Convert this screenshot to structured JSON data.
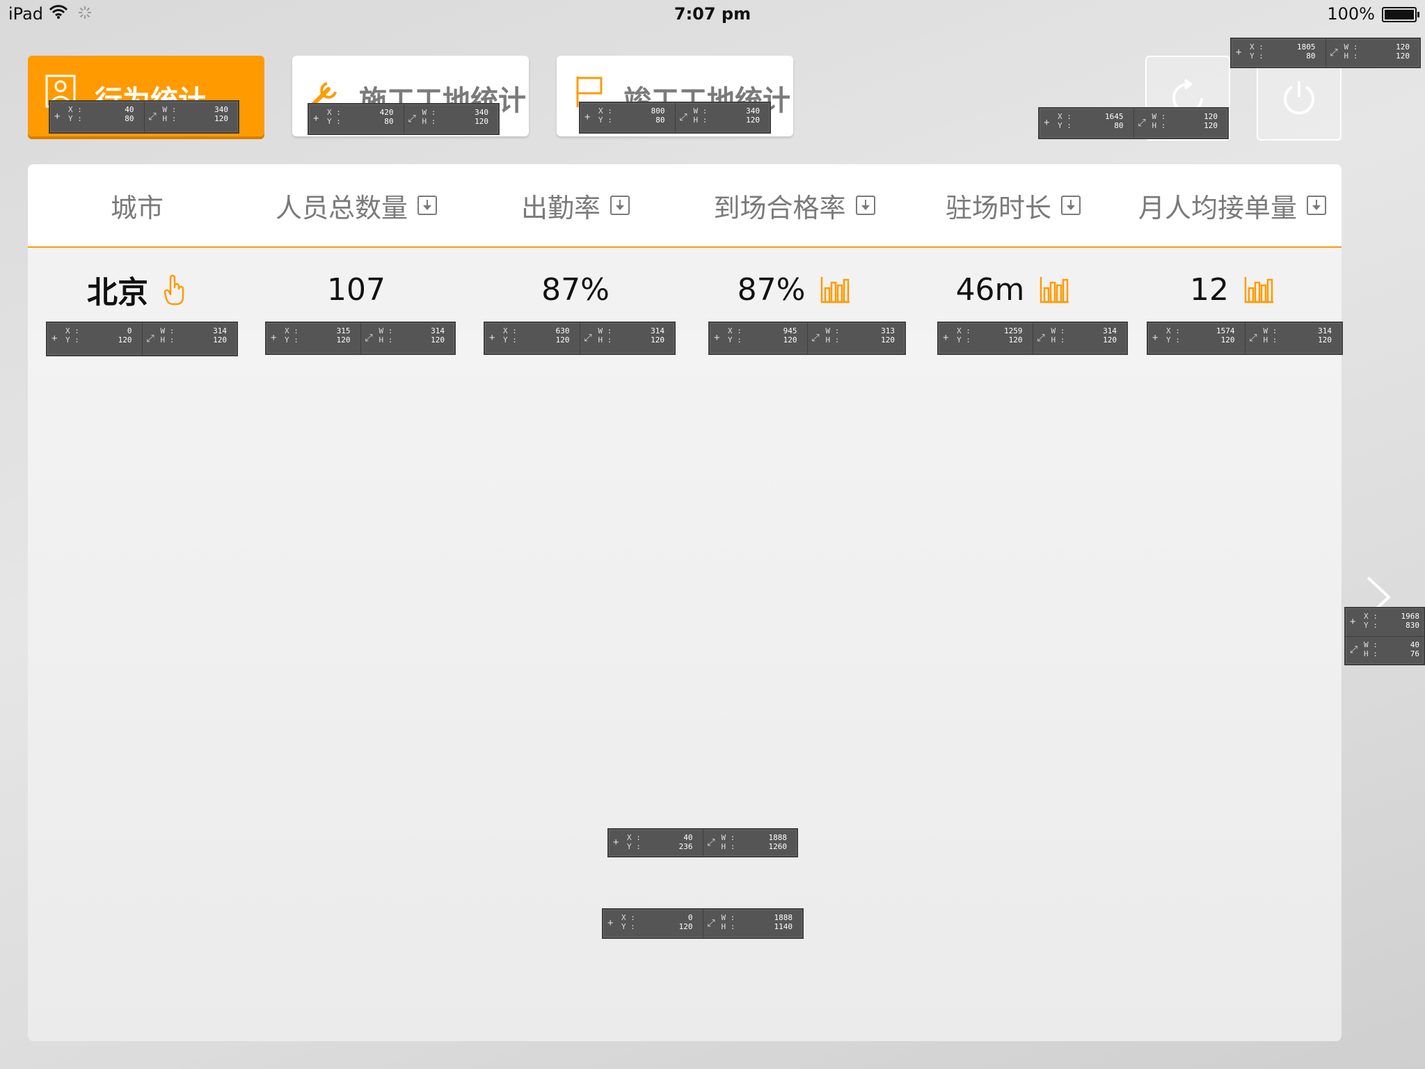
{
  "status_bar": {
    "device": "iPad",
    "time": "7:07 pm",
    "battery": "100%",
    "battery_level": 1.0
  },
  "tabs": [
    {
      "label": "行为统计",
      "icon": "person-card-icon",
      "active": true
    },
    {
      "label": "施工工地统计",
      "icon": "wrench-icon",
      "active": false
    },
    {
      "label": "竣工工地统计",
      "icon": "flag-icon",
      "active": false
    }
  ],
  "toolbar": {
    "refresh_icon": "refresh-icon",
    "power_icon": "power-icon"
  },
  "table": {
    "headers": [
      "城市",
      "人员总数量",
      "出勤率",
      "到场合格率",
      "驻场时长",
      "月人均接单量"
    ],
    "rows": [
      {
        "city": "北京",
        "total": "107",
        "attendance": "87%",
        "qualified": "87%",
        "duration": "46m",
        "monthly_orders": "12"
      }
    ]
  },
  "overlays": [
    {
      "x": "40",
      "y": "80",
      "w": "340",
      "h": "120"
    },
    {
      "x": "420",
      "y": "80",
      "w": "340",
      "h": "120"
    },
    {
      "x": "800",
      "y": "80",
      "w": "340",
      "h": "120"
    },
    {
      "x": "1645",
      "y": "80",
      "w": "120",
      "h": "120"
    },
    {
      "x": "1805",
      "y": "80",
      "w": "120",
      "h": "120"
    },
    {
      "x": "0",
      "y": "120",
      "w": "314",
      "h": "120"
    },
    {
      "x": "315",
      "y": "120",
      "w": "314",
      "h": "120"
    },
    {
      "x": "630",
      "y": "120",
      "w": "314",
      "h": "120"
    },
    {
      "x": "945",
      "y": "120",
      "w": "313",
      "h": "120"
    },
    {
      "x": "1259",
      "y": "120",
      "w": "314",
      "h": "120"
    },
    {
      "x": "1574",
      "y": "120",
      "w": "314",
      "h": "120"
    },
    {
      "x": "1968",
      "y": "830",
      "w": "40",
      "h": "76"
    },
    {
      "x": "40",
      "y": "236",
      "w": "1888",
      "h": "1260"
    },
    {
      "x": "0",
      "y": "120",
      "w": "1888",
      "h": "1140"
    }
  ],
  "colors": {
    "accent": "#ff9b00",
    "header_text": "#7a7a7a",
    "body_text": "#111111"
  }
}
